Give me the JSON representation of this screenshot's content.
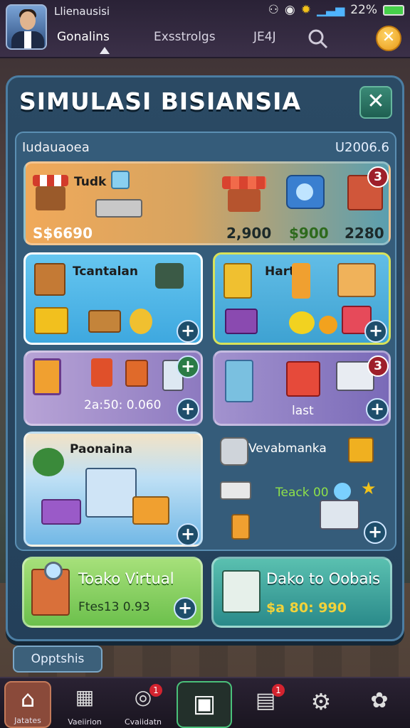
{
  "status_bar": {
    "username": "Llienausisi",
    "battery": "22%"
  },
  "header_tabs": [
    {
      "label": "Gonalins"
    },
    {
      "label": "Exsstrolgs"
    },
    {
      "label": "JE4J"
    }
  ],
  "panel": {
    "title": "SIMULASI BISIANSIA",
    "inner_label": "Iudauaoea",
    "inner_value": "U2006.6"
  },
  "top_card": {
    "title": "Tudk",
    "prices": [
      "S$6690",
      "2,900",
      "$900",
      "2280"
    ],
    "badge": "3"
  },
  "cards": [
    {
      "title": "Tcantalan"
    },
    {
      "title": "Hart"
    },
    {
      "title": "",
      "value": "2a:50: 0.060"
    },
    {
      "title": "",
      "value": "last",
      "badge": "3"
    },
    {
      "title": "Paonaina"
    },
    {
      "title": "Vevabmanka",
      "value": "Teack 00"
    }
  ],
  "bottom_cards": [
    {
      "title": "Toako Virtual",
      "value": "Ftes13 0.93"
    },
    {
      "title": "Dako to Oobais",
      "value": "$a 80: 990"
    }
  ],
  "options_button": "Opptshis",
  "bottom_nav": [
    {
      "label": "Jatates",
      "icon": "home-icon"
    },
    {
      "label": "Vaeiirion",
      "icon": "store-icon"
    },
    {
      "label": "Cvaiidatn",
      "icon": "coin-icon",
      "badge": "1"
    },
    {
      "label": "",
      "icon": "center-icon"
    },
    {
      "label": "",
      "icon": "inventory-icon",
      "badge": "1"
    },
    {
      "label": "",
      "icon": "gear-icon"
    },
    {
      "label": "",
      "icon": "chat-icon"
    }
  ],
  "colors": {
    "accent_orange": "#e89a18",
    "teal": "#1f6052",
    "panel_blue": "#24405a"
  }
}
